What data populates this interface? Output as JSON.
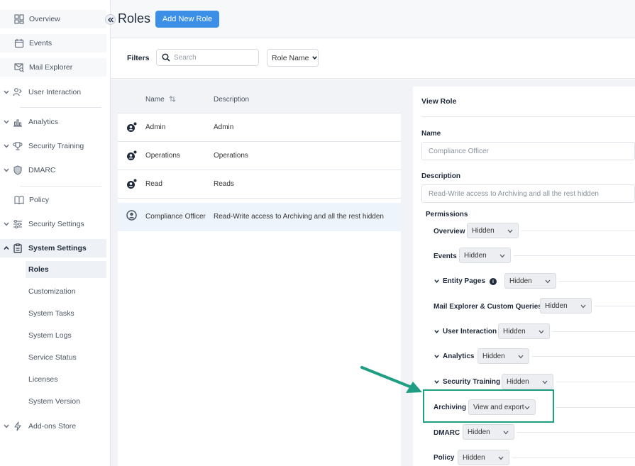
{
  "sidebar": {
    "items": [
      {
        "label": "Overview",
        "icon": "dashboard-icon"
      },
      {
        "label": "Events",
        "icon": "calendar-icon"
      },
      {
        "label": "Mail Explorer",
        "icon": "mail-search-icon"
      },
      {
        "label": "User Interaction",
        "icon": "user-interaction-icon"
      },
      {
        "label": "Analytics",
        "icon": "analytics-icon"
      },
      {
        "label": "Security Training",
        "icon": "trophy-icon"
      },
      {
        "label": "DMARC",
        "icon": "shield-icon"
      },
      {
        "label": "Policy",
        "icon": "book-icon"
      },
      {
        "label": "Security Settings",
        "icon": "sliders-icon"
      },
      {
        "label": "System Settings",
        "icon": "clipboard-icon"
      }
    ],
    "system_settings_children": [
      "Roles",
      "Customization",
      "System Tasks",
      "System Logs",
      "Service Status",
      "Licenses",
      "System Version"
    ],
    "addons": {
      "label": "Add-ons Store",
      "icon": "bolt-icon"
    }
  },
  "header": {
    "title": "Roles",
    "add_button": "Add New Role"
  },
  "filters": {
    "label": "Filters",
    "search_placeholder": "Search",
    "sort_button": "Role Name"
  },
  "table": {
    "columns": {
      "name": "Name",
      "description": "Description"
    },
    "rows": [
      {
        "name": "Admin",
        "description": "Admin"
      },
      {
        "name": "Operations",
        "description": "Operations"
      },
      {
        "name": "Read",
        "description": "Reads"
      },
      {
        "name": "Compliance Officer",
        "description": "Read-Write access to Archiving and all the rest hidden"
      }
    ]
  },
  "view_role": {
    "title": "View Role",
    "name_label": "Name",
    "name_value": "Compliance Officer",
    "description_label": "Description",
    "description_value": "Read-Write access to Archiving and all the rest hidden",
    "permissions_label": "Permissions",
    "permissions": [
      {
        "name": "Overview",
        "value": "Hidden"
      },
      {
        "name": "Events",
        "value": "Hidden"
      },
      {
        "name": "Entity Pages",
        "value": "Hidden"
      },
      {
        "name": "Mail Explorer & Custom Queries",
        "value": "Hidden"
      },
      {
        "name": "User Interaction",
        "value": "Hidden"
      },
      {
        "name": "Analytics",
        "value": "Hidden"
      },
      {
        "name": "Security Training",
        "value": "Hidden"
      },
      {
        "name": "Archiving",
        "value": "View and export"
      },
      {
        "name": "DMARC",
        "value": "Hidden"
      },
      {
        "name": "Policy",
        "value": "Hidden"
      }
    ],
    "info_glyph": "i"
  },
  "colors": {
    "accent": "#3b8fe6",
    "highlight": "#1f9e83"
  }
}
